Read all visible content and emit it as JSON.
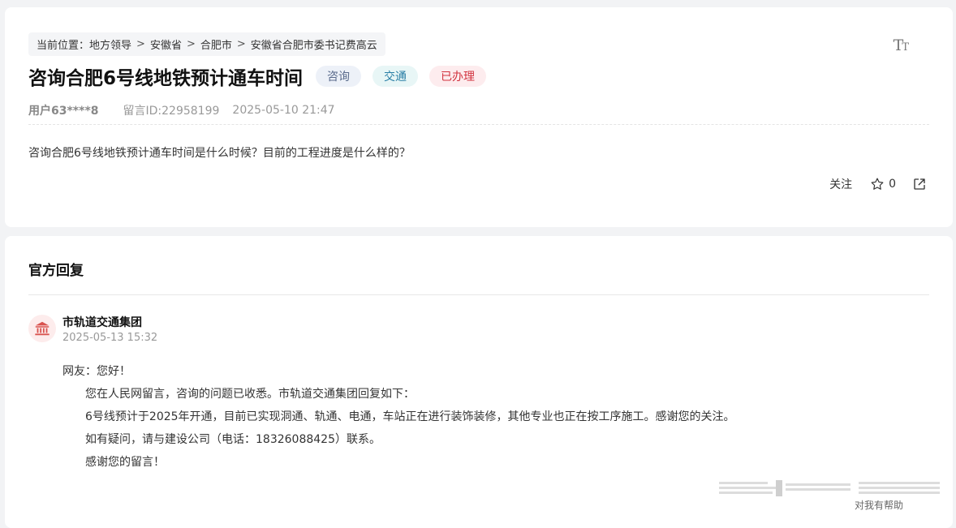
{
  "breadcrumb": {
    "label": "当前位置：",
    "items": [
      "地方领导",
      "安徽省",
      "合肥市",
      "安徽省合肥市委书记费高云"
    ],
    "separator": ">"
  },
  "font_size_toggle": "TT",
  "question": {
    "title": "咨询合肥6号线地铁预计通车时间",
    "tags": [
      "咨询",
      "交通",
      "已办理"
    ],
    "user": "用户63****8",
    "message_id": "留言ID:22958199",
    "datetime": "2025-05-10 21:47",
    "content": "咨询合肥6号线地铁预计通车时间是什么时候？目前的工程进度是什么样的？"
  },
  "actions": {
    "follow_label": "关注",
    "star_count": "0"
  },
  "reply": {
    "heading": "官方回复",
    "org_name": "市轨道交通集团",
    "datetime": "2025-05-13 15:32",
    "greeting": "网友：您好！",
    "paragraphs": [
      "您在人民网留言，咨询的问题已收悉。市轨道交通集团回复如下：",
      "6号线预计于2025年开通，目前已实现洞通、轨通、电通，车站正在进行装饰装修，其他专业也正在按工序施工。感谢您的关注。",
      "如有疑问，请与建设公司（电话：18326088425）联系。",
      "感谢您的留言！"
    ]
  },
  "bottom_label": "对我有帮助",
  "colors": {
    "tag_consult": "#5a6b8c",
    "tag_traffic": "#2a7fa6",
    "tag_done": "#d2333f",
    "org_icon": "#d9534f"
  },
  "icons": [
    "star-icon",
    "share-icon",
    "government-building-icon"
  ]
}
